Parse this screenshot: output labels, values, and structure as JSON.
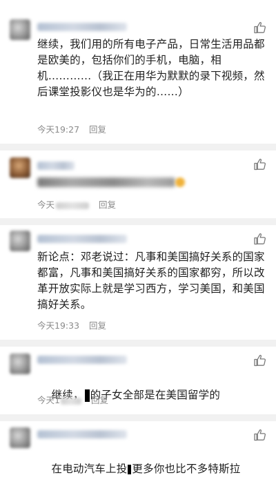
{
  "comments": [
    {
      "text": "继续，我们用的所有电子产品，日常生活用品都是欧美的，包括你们的手机，电脑，相机…………（我正在用华为默默的录下视频，然后课堂投影仪也是华为的……）",
      "time": "今天19:27",
      "reply": "回复"
    },
    {
      "time": "今天",
      "reply": "回复"
    },
    {
      "text": "新论点：邓老说过：凡事和美国搞好关系的国家都富，凡事和美国搞好关系的国家都穷，所以改革开放实际上就是学习西方，学习美国，和美国搞好关系。",
      "time": "今天19:33",
      "reply": "回复"
    },
    {
      "text_a": "继续，",
      "text_b": "的子女全部是在美国留学的",
      "time": "今天1",
      "reply": "回复"
    },
    {
      "text_a": "在电动汽车上投",
      "text_b": "更多你也比不多特斯拉"
    }
  ],
  "icons": {
    "like": "thumbs-up-icon"
  }
}
